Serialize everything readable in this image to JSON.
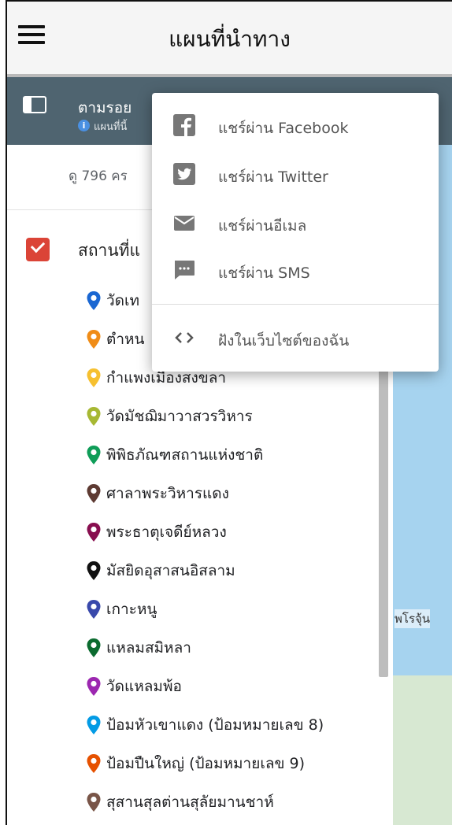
{
  "appbar": {
    "title": "แผนที่นำทาง"
  },
  "panel": {
    "layer_title": "ตามรอย",
    "subtitle": "แผนที่นี้",
    "info_icon": "info-icon"
  },
  "list": {
    "views": "ดู 796 คร",
    "group_label": "สถานที่แ",
    "places": [
      {
        "label": "วัดเท",
        "color": "#1a67d2"
      },
      {
        "label": "ตำหน",
        "color": "#f08c17"
      },
      {
        "label": "กำแพงเมืองสงขลา",
        "color": "#f6c030"
      },
      {
        "label": "วัดมัชฌิมาวาสวรวิหาร",
        "color": "#a7b833"
      },
      {
        "label": "พิพิธภัณฑสถานแห่งชาติ",
        "color": "#0f9d58"
      },
      {
        "label": "ศาลาพระวิหารแดง",
        "color": "#5d3a32"
      },
      {
        "label": "พระธาตุเจดีย์หลวง",
        "color": "#880e4f"
      },
      {
        "label": "มัสยิดอุสาสนอิสลาม",
        "color": "#111111"
      },
      {
        "label": "เกาะหนู",
        "color": "#3949ab"
      },
      {
        "label": "แหลมสมิหลา",
        "color": "#0b6b2f"
      },
      {
        "label": "วัดแหลมพ้อ",
        "color": "#9c27b0"
      },
      {
        "label": "ป้อมหัวเขาแดง (ป้อมหมายเลข 8)",
        "color": "#039be5"
      },
      {
        "label": "ป้อมปืนใหญ่ (ป้อมหมายเลข 9)",
        "color": "#e65100"
      },
      {
        "label": "สุสานสุลต่านสุลัยมานชาห์",
        "color": "#795548"
      }
    ]
  },
  "map": {
    "label": "พโรจุ้น"
  },
  "share_menu": {
    "items": [
      {
        "label": "แชร์ผ่าน Facebook",
        "icon": "facebook-icon"
      },
      {
        "label": "แชร์ผ่าน Twitter",
        "icon": "twitter-icon"
      },
      {
        "label": "แชร์ผ่านอีเมล",
        "icon": "email-icon"
      },
      {
        "label": "แชร์ผ่าน SMS",
        "icon": "sms-icon"
      }
    ],
    "embed": {
      "label": "ฝังในเว็บไซต์ของฉัน",
      "icon": "embed-code-icon"
    }
  }
}
